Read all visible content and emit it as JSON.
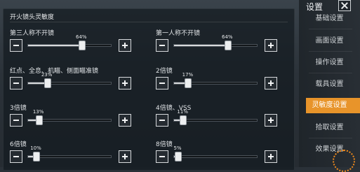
{
  "section_title": "开火镜头灵敏度",
  "settings": [
    {
      "label": "第三人称不开镜",
      "pct_text": "64%",
      "value": 0.64
    },
    {
      "label": "第一人称不开镜",
      "pct_text": "64%",
      "value": 0.64
    },
    {
      "label": "红点、全息、机瞄、侧面瞄准镜",
      "pct_text": "23%",
      "value": 0.23
    },
    {
      "label": "2倍镜",
      "pct_text": "17%",
      "value": 0.17
    },
    {
      "label": "3倍镜",
      "pct_text": "13%",
      "value": 0.13
    },
    {
      "label": "4倍镜、VSS",
      "pct_text": "11%",
      "value": 0.11
    },
    {
      "label": "6倍镜",
      "pct_text": "10%",
      "value": 0.1
    },
    {
      "label": "8倍镜",
      "pct_text": "5%",
      "value": 0.05
    }
  ],
  "sidebar": {
    "title": "设置",
    "items": [
      {
        "label": "基础设置",
        "active": false
      },
      {
        "label": "画面设置",
        "active": false
      },
      {
        "label": "操作设置",
        "active": false
      },
      {
        "label": "载具设置",
        "active": false
      },
      {
        "label": "灵敏度设置",
        "active": true
      },
      {
        "label": "拾取设置",
        "active": false
      },
      {
        "label": "效果设置",
        "active": false
      }
    ]
  },
  "colors": {
    "accent": "#e8942a",
    "panel_bg": "#141a20"
  }
}
